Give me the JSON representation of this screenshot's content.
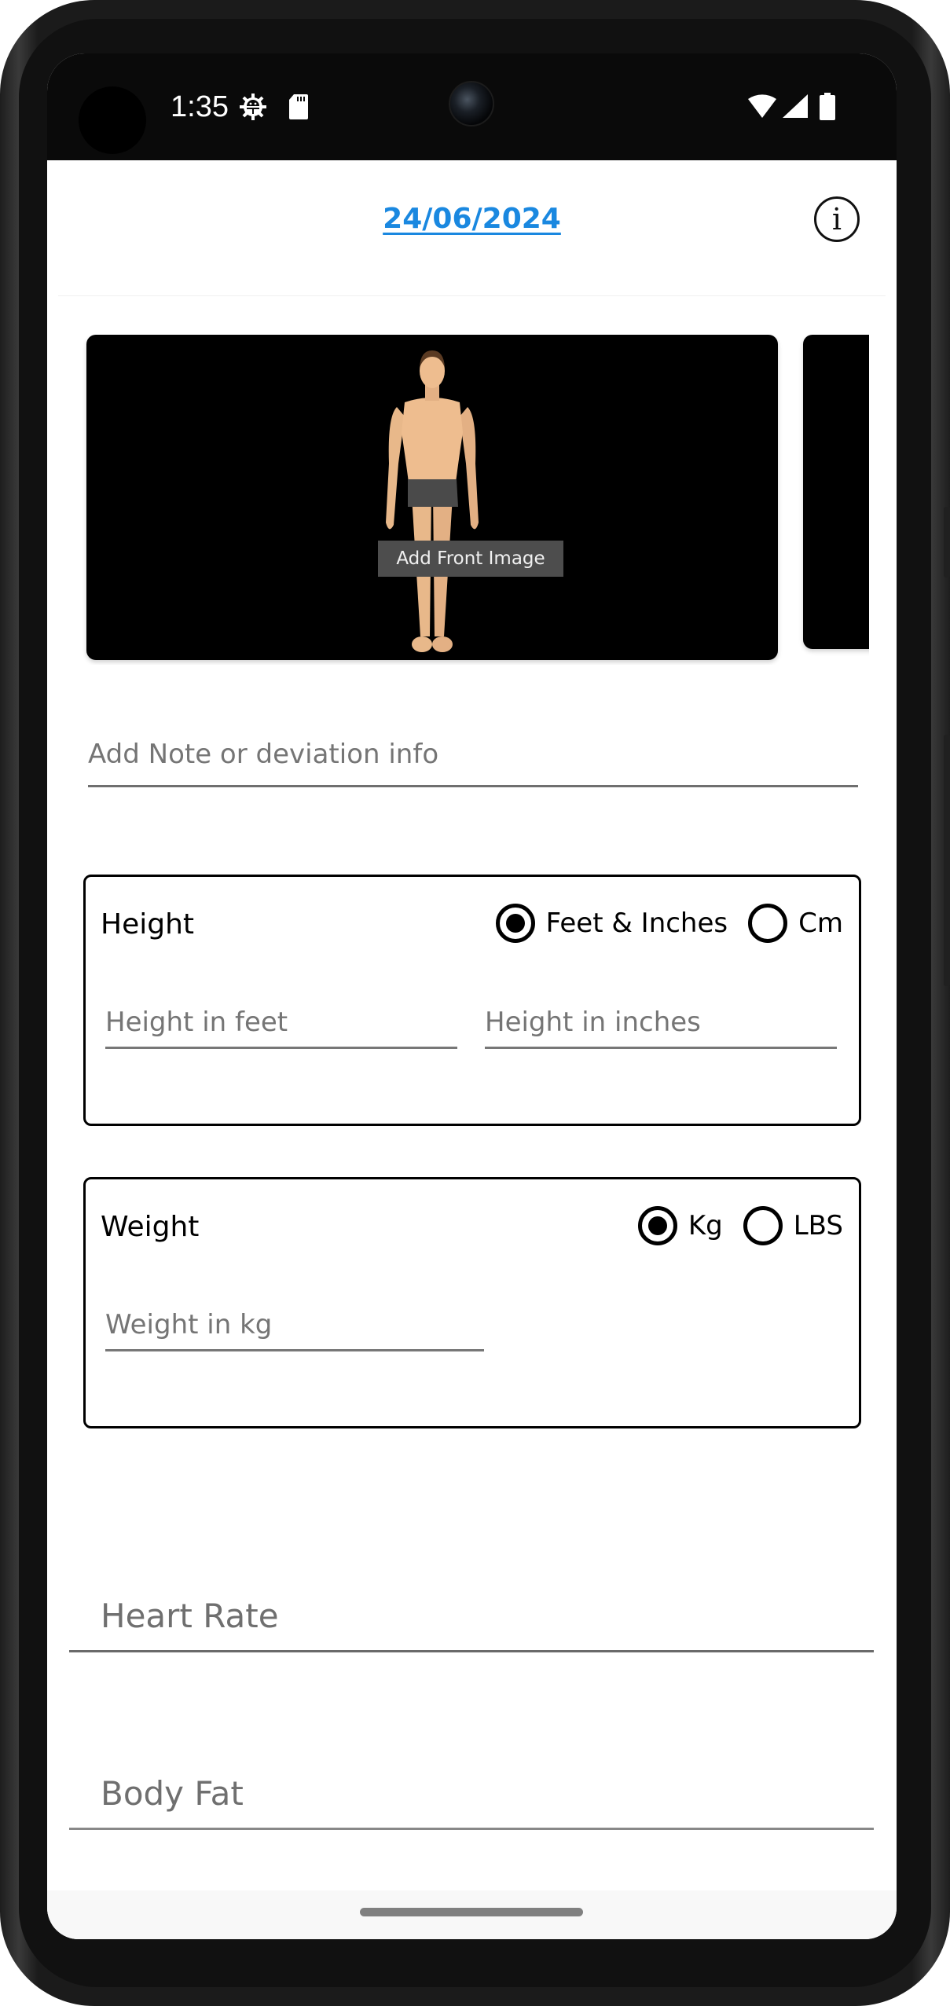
{
  "status_bar": {
    "time": "1:35",
    "icons": [
      "gear-icon",
      "sd-card-icon",
      "wifi-icon",
      "signal-icon",
      "battery-icon"
    ]
  },
  "header": {
    "date": "24/06/2024",
    "info_icon": "info-icon",
    "accent_color": "#1a88e0"
  },
  "images": {
    "front_label": "Add Front Image"
  },
  "note": {
    "placeholder": "Add Note or deviation info",
    "value": ""
  },
  "height": {
    "title": "Height",
    "units": [
      {
        "label": "Feet & Inches",
        "selected": true
      },
      {
        "label": "Cm",
        "selected": false
      }
    ],
    "feet_placeholder": "Height in feet",
    "inches_placeholder": "Height in inches"
  },
  "weight": {
    "title": "Weight",
    "units": [
      {
        "label": "Kg",
        "selected": true
      },
      {
        "label": "LBS",
        "selected": false
      }
    ],
    "kg_placeholder": "Weight in kg"
  },
  "heart_rate": {
    "placeholder": "Heart Rate"
  },
  "body_fat": {
    "placeholder": "Body Fat"
  }
}
